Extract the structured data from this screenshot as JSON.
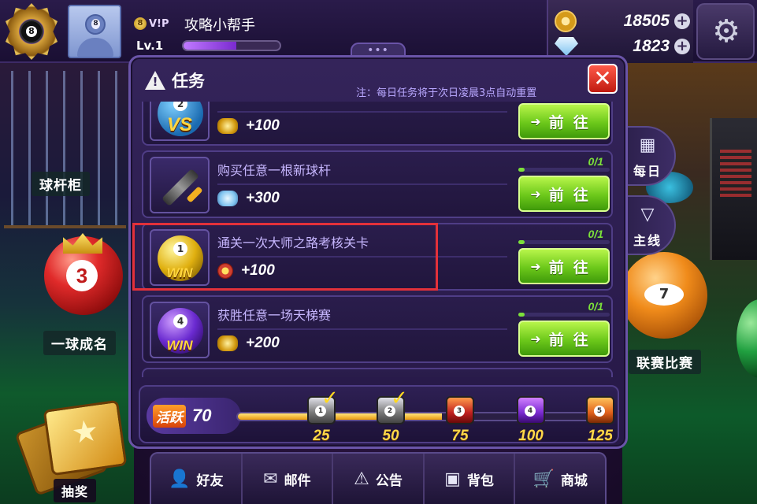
{
  "topbar": {
    "vip_label": "V!P",
    "username": "攻略小帮手",
    "level": "Lv.1",
    "xp_fraction": 0.55,
    "coins": "18505",
    "diamonds": "1823",
    "rank_badge_number": "8",
    "avatar_number": "8"
  },
  "scene": {
    "cue_cabinet": "球杆柜",
    "one_ball": "一球成名",
    "league": "联赛比赛",
    "lottery": "抽奖"
  },
  "side_tabs": {
    "daily": "每日",
    "main": "主线"
  },
  "panel": {
    "title": "任务",
    "note": "注：每日任务将于次日凌晨3点自动重置",
    "close_label": "✕",
    "quests": [
      {
        "title": "",
        "reward_type": "gold",
        "reward": "+100",
        "progress": "",
        "go": "前往",
        "icon": "vs",
        "icon_text": "VS",
        "icon_number": "2"
      },
      {
        "title": "购买任意一根新球杆",
        "reward_type": "gems",
        "reward": "+300",
        "progress": "0/1",
        "go": "前往",
        "icon": "cue",
        "icon_text": "",
        "icon_number": ""
      },
      {
        "title": "通关一次大师之路考核关卡",
        "reward_type": "medal",
        "reward": "+100",
        "progress": "0/1",
        "go": "前往",
        "icon": "win",
        "icon_text": "WIN",
        "icon_number": "1"
      },
      {
        "title": "获胜任意一场天梯赛",
        "reward_type": "gold",
        "reward": "+200",
        "progress": "0/1",
        "go": "前往",
        "icon": "win4",
        "icon_text": "WIN",
        "icon_number": "4"
      }
    ],
    "activity": {
      "label": "活跃",
      "value": "70",
      "fill_fraction": 0.56,
      "milestones": [
        {
          "value": "25",
          "num": "1",
          "style": "silver",
          "claimed": true
        },
        {
          "value": "50",
          "num": "2",
          "style": "silver",
          "claimed": true
        },
        {
          "value": "75",
          "num": "3",
          "style": "red",
          "claimed": false
        },
        {
          "value": "100",
          "num": "4",
          "style": "purple",
          "claimed": false
        },
        {
          "value": "125",
          "num": "5",
          "style": "orange",
          "claimed": false
        }
      ]
    }
  },
  "bottom_nav": [
    {
      "label": "好友",
      "icon": "friends-icon"
    },
    {
      "label": "邮件",
      "icon": "mail-icon"
    },
    {
      "label": "公告",
      "icon": "announcement-icon"
    },
    {
      "label": "背包",
      "icon": "backpack-icon"
    },
    {
      "label": "商城",
      "icon": "shop-cart-icon"
    }
  ],
  "colors": {
    "accent_green": "#7ce03a",
    "highlight_red": "#e3313a",
    "panel_bg": "#2b1d4c"
  }
}
